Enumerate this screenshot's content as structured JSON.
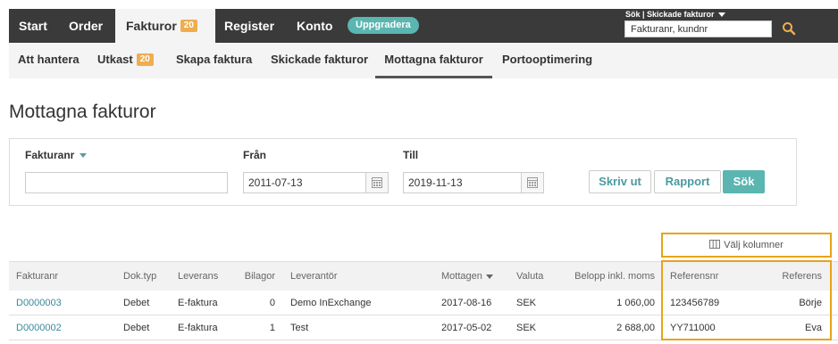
{
  "topnav": {
    "items": [
      {
        "label": "Start"
      },
      {
        "label": "Order"
      },
      {
        "label": "Fakturor",
        "badge": "20"
      },
      {
        "label": "Register"
      },
      {
        "label": "Konto"
      }
    ],
    "upgrade_label": "Uppgradera",
    "search_label": "Sök | Skickade fakturor",
    "search_placeholder": "Fakturanr, kundnr"
  },
  "subnav": {
    "items": [
      {
        "label": "Att hantera"
      },
      {
        "label": "Utkast",
        "badge": "20"
      },
      {
        "label": "Skapa faktura"
      },
      {
        "label": "Skickade fakturor"
      },
      {
        "label": "Mottagna fakturor"
      },
      {
        "label": "Portooptimering"
      }
    ]
  },
  "page_title": "Mottagna fakturor",
  "filters": {
    "invoice_label": "Fakturanr",
    "invoice_value": "",
    "from_label": "Från",
    "from_value": "2011-07-13",
    "to_label": "Till",
    "to_value": "2019-11-13",
    "print_label": "Skriv ut",
    "report_label": "Rapport",
    "search_label": "Sök"
  },
  "choose_columns_label": "Välj kolumner",
  "table": {
    "headers": {
      "invoice_no": "Fakturanr",
      "doc_type": "Dok.typ",
      "delivery": "Leverans",
      "attachments": "Bilagor",
      "supplier": "Leverantör",
      "received": "Mottagen",
      "currency": "Valuta",
      "amount": "Belopp inkl. moms",
      "ref_no": "Referensnr",
      "reference": "Referens"
    },
    "rows": [
      {
        "invoice_no": "D0000003",
        "doc_type": "Debet",
        "delivery": "E-faktura",
        "attachments": "0",
        "supplier": "Demo InExchange",
        "received": "2017-08-16",
        "currency": "SEK",
        "amount": "1 060,00",
        "ref_no": "123456789",
        "reference": "Börje"
      },
      {
        "invoice_no": "D0000002",
        "doc_type": "Debet",
        "delivery": "E-faktura",
        "attachments": "1",
        "supplier": "Test",
        "received": "2017-05-02",
        "currency": "SEK",
        "amount": "2 688,00",
        "ref_no": "YY711000",
        "reference": "Eva"
      }
    ]
  },
  "colors": {
    "topbar": "#3a3a3a",
    "accent": "#5bb5b0",
    "badge": "#f0ad4e",
    "highlight": "#e8a317",
    "link": "#3a8a9a"
  }
}
